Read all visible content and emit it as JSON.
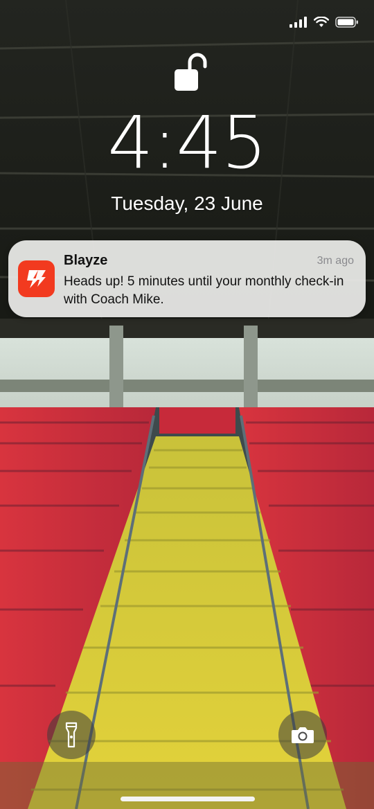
{
  "status_bar": {
    "signal_icon": "cellular-signal-icon",
    "wifi_icon": "wifi-icon",
    "battery_icon": "battery-icon"
  },
  "lock": {
    "icon": "unlocked-padlock-icon"
  },
  "clock": {
    "time": "4:45"
  },
  "date": {
    "label": "Tuesday, 23 June"
  },
  "notification": {
    "app_icon": "blayze-logo-icon",
    "app_name": "Blayze",
    "time_ago": "3m ago",
    "message": "Heads up! 5 minutes until your monthly check-in with Coach Mike.",
    "accent_color": "#f23a1f"
  },
  "quick_actions": {
    "flashlight_icon": "flashlight-icon",
    "camera_icon": "camera-icon"
  }
}
